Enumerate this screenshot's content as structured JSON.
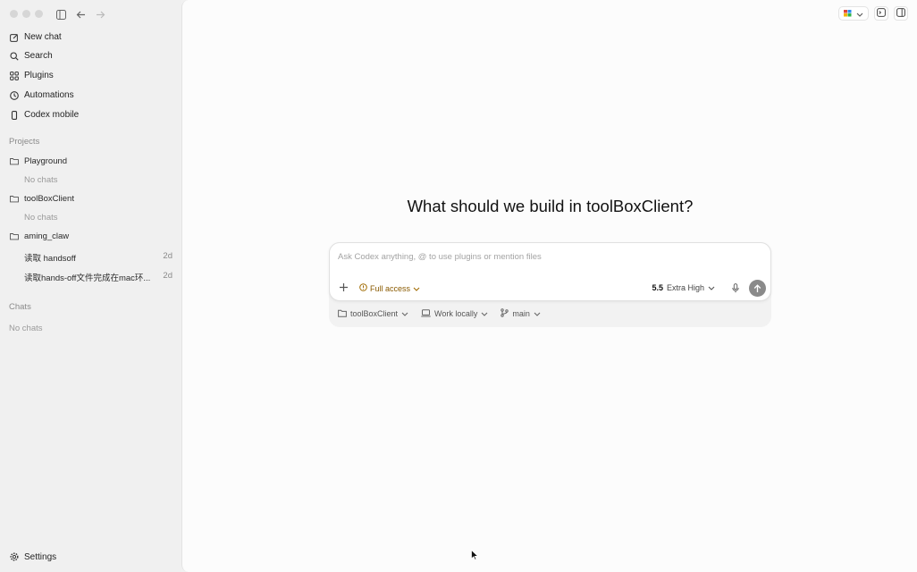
{
  "sidebar": {
    "nav": [
      {
        "label": "New chat",
        "icon": "new-chat-icon"
      },
      {
        "label": "Search",
        "icon": "search-icon"
      },
      {
        "label": "Plugins",
        "icon": "plugins-icon"
      },
      {
        "label": "Automations",
        "icon": "automations-icon"
      },
      {
        "label": "Codex mobile",
        "icon": "mobile-icon"
      }
    ],
    "projects_label": "Projects",
    "projects": [
      {
        "name": "Playground",
        "empty_text": "No chats"
      },
      {
        "name": "toolBoxClient",
        "empty_text": "No chats"
      },
      {
        "name": "aming_claw"
      }
    ],
    "project_chats": [
      {
        "title": "读取 handsoff",
        "age": "2d"
      },
      {
        "title": "读取hands-off文件完成在mac环...",
        "age": "2d"
      }
    ],
    "chats_label": "Chats",
    "chats_empty": "No chats",
    "settings_label": "Settings"
  },
  "main": {
    "headline": "What should we build in toolBoxClient?",
    "composer": {
      "placeholder": "Ask Codex anything, @ to use plugins or mention files",
      "access_label": "Full access",
      "model_version": "5.5",
      "model_effort": "Extra High"
    },
    "context_bar": {
      "project": "toolBoxClient",
      "location": "Work locally",
      "branch": "main"
    }
  }
}
